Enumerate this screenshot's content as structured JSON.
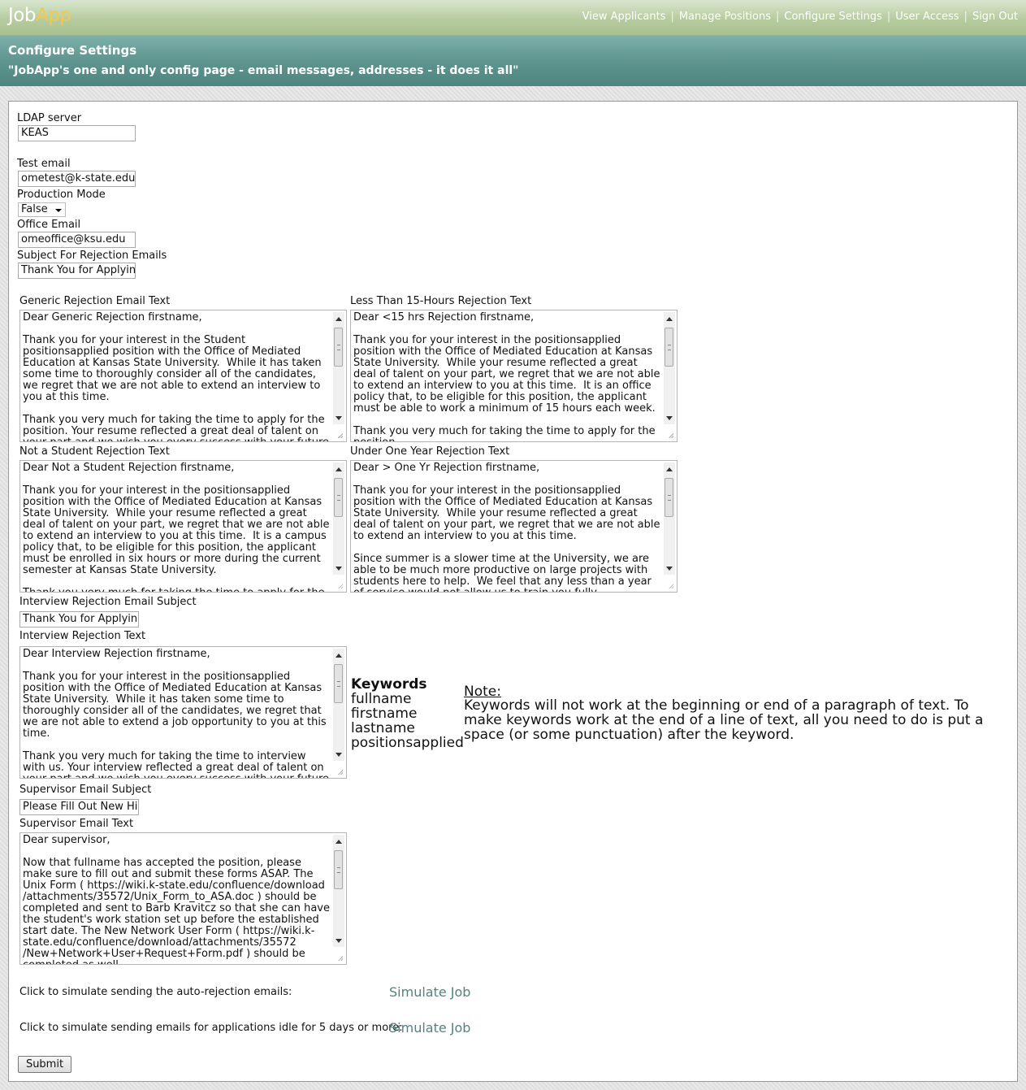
{
  "app": {
    "logo_job": "Job",
    "logo_app": "App"
  },
  "nav": {
    "view_applicants": "View Applicants",
    "manage_positions": "Manage Positions",
    "configure_settings": "Configure Settings",
    "user_access": "User Access",
    "sign_out": "Sign Out",
    "separator": "|"
  },
  "header": {
    "title": "Configure Settings",
    "subtitle": "\"JobApp's one and only config page - email messages, addresses - it does it all\""
  },
  "fields": {
    "ldap_label": "LDAP server",
    "ldap_value": "KEAS",
    "test_email_label": "Test email",
    "test_email_value": "ometest@k-state.edu",
    "production_label": "Production Mode",
    "production_value": "False",
    "office_email_label": "Office Email",
    "office_email_value": "omeoffice@ksu.edu",
    "rejection_subject_label": "Subject For Rejection Emails",
    "rejection_subject_value": "Thank You for Applying"
  },
  "textareas": {
    "generic": {
      "label": "Generic Rejection Email Text",
      "text": "Dear Generic Rejection firstname,\n\nThank you for your interest in the Student positionsapplied position with the Office of Mediated Education at Kansas State University.  While it has taken some time to thoroughly consider all of the candidates, we regret that we are not able to extend an interview to you at this time.\n\nThank you very much for taking the time to apply for the position. Your resume reflected a great deal of talent on your part and we wish you every success with your future endeavors."
    },
    "less15": {
      "label": "Less Than 15-Hours Rejection Text",
      "text": "Dear <15 hrs Rejection firstname,\n\nThank you for your interest in the positionsapplied position with the Office of Mediated Education at Kansas State University.  While your resume reflected a great deal of talent on your part, we regret that we are not able to extend an interview to you at this time.  It is an office policy that, to be eligible for this position, the applicant must be able to work a minimum of 15 hours each week.\n\nThank you very much for taking the time to apply for the position."
    },
    "notstudent": {
      "label": "Not a Student Rejection Text",
      "text": "Dear Not a Student Rejection firstname,\n\nThank you for your interest in the positionsapplied position with the Office of Mediated Education at Kansas State University.  While your resume reflected a great deal of talent on your part, we regret that we are not able to extend an interview to you at this time.  It is a campus policy that, to be eligible for this position, the applicant must be enrolled in six hours or more during the current semester at Kansas State University.\n\nThank you very much for taking the time to apply for the position."
    },
    "underyear": {
      "label": "Under One Year Rejection Text",
      "text": "Dear > One Yr Rejection firstname,\n\nThank you for your interest in the positionsapplied position with the Office of Mediated Education at Kansas State University.  While your resume reflected a great deal of talent on your part, we regret that we are not able to extend an interview to you at this time.\n\nSince summer is a slower time at the University, we are able to be much more productive on large projects with students here to help.  We feel that any less than a year of service would not allow us to train you fully."
    },
    "interview": {
      "label": "Interview Rejection Text",
      "text": "Dear Interview Rejection firstname,\n\nThank you for your interest in the positionsapplied position with the Office of Mediated Education at Kansas State University.  While it has taken some time to thoroughly consider all of the candidates, we regret that we are not able to extend a job opportunity to you at this time.\n\nThank you very much for taking the time to interview with us. Your interview reflected a great deal of talent on your part and we wish you every success with your future endeavors."
    },
    "supervisor": {
      "label": "Supervisor Email Text",
      "text": "Dear supervisor,\n\nNow that fullname has accepted the position, please make sure to fill out and submit these forms ASAP. The Unix Form ( https://wiki.k-state.edu/confluence/download /attachments/35572/Unix_Form_to_ASA.doc ) should be completed and sent to Barb Kravitcz so that she can have the student's work station set up before the established start date. The New Network User Form ( https://wiki.k-state.edu/confluence/download/attachments/35572 /New+Network+User+Request+Form.pdf ) should be completed as well."
    }
  },
  "interview_subject": {
    "label": "Interview Rejection Email Subject",
    "value": "Thank You for Applying"
  },
  "supervisor_subject": {
    "label": "Supervisor Email Subject",
    "value": "Please Fill Out New Hire Forms"
  },
  "keywords": {
    "title": "Keywords",
    "items": [
      "fullname",
      "firstname",
      "lastname",
      "positionsapplied"
    ]
  },
  "note": {
    "title": "Note:",
    "text": "Keywords will not work at the beginning or end of a paragraph of text. To make keywords work at the end of a line of text, all you need to do is put a space (or some punctuation) after the keyword."
  },
  "simulate": {
    "auto_rejection_label": "Click to simulate sending the auto-rejection emails:",
    "idle_label": "Click to simulate sending emails for applications idle for 5 days or more:",
    "link_text": "Simulate Job"
  },
  "submit_label": "Submit"
}
